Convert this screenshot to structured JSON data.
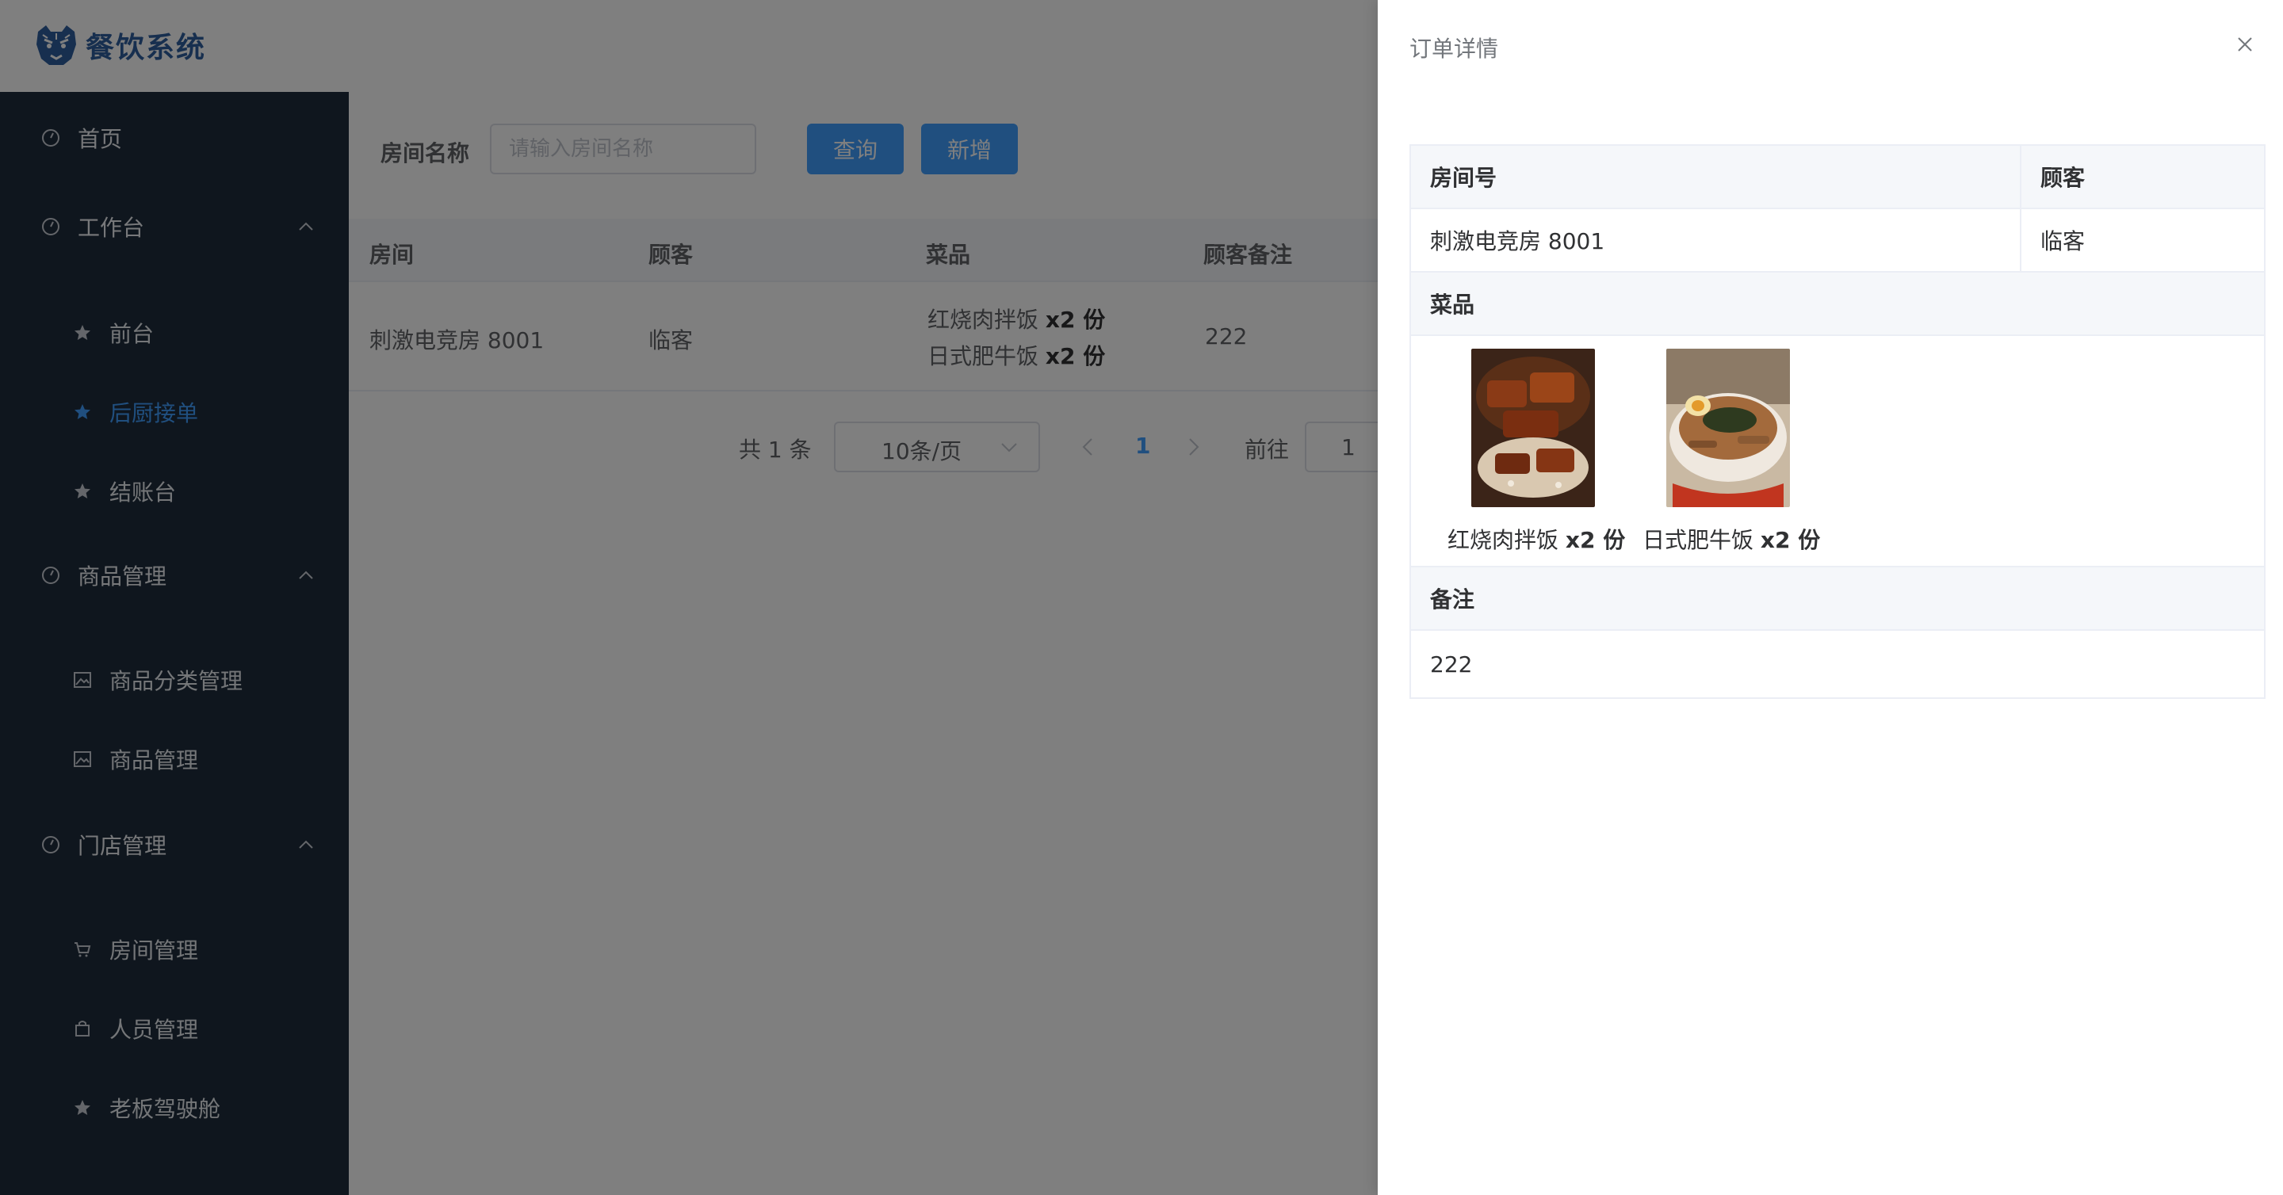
{
  "app": {
    "title": "餐饮系统"
  },
  "sidebar": {
    "items": [
      {
        "label": "首页",
        "icon": "dashboard-icon"
      },
      {
        "label": "工作台",
        "icon": "dashboard-icon",
        "children": [
          {
            "label": "前台",
            "icon": "star-icon"
          },
          {
            "label": "后厨接单",
            "icon": "star-icon",
            "active": true
          },
          {
            "label": "结账台",
            "icon": "star-icon"
          }
        ]
      },
      {
        "label": "商品管理",
        "icon": "dashboard-icon",
        "children": [
          {
            "label": "商品分类管理",
            "icon": "picture-icon"
          },
          {
            "label": "商品管理",
            "icon": "picture-icon"
          }
        ]
      },
      {
        "label": "门店管理",
        "icon": "dashboard-icon",
        "children": [
          {
            "label": "房间管理",
            "icon": "cart-icon"
          },
          {
            "label": "人员管理",
            "icon": "bag-icon"
          },
          {
            "label": "老板驾驶舱",
            "icon": "star-icon"
          }
        ]
      }
    ]
  },
  "search": {
    "label": "房间名称",
    "placeholder": "请输入房间名称",
    "query_button": "查询",
    "add_button": "新增"
  },
  "table": {
    "headers": [
      "房间",
      "顾客",
      "菜品",
      "顾客备注"
    ],
    "rows": [
      {
        "room": "刺激电竞房 8001",
        "customer": "临客",
        "dishes": [
          {
            "name": "红烧肉拌饭",
            "qty": "x2 份"
          },
          {
            "name": "日式肥牛饭",
            "qty": "x2 份"
          }
        ],
        "note": "222"
      }
    ]
  },
  "pagination": {
    "total": "共 1 条",
    "page_size": "10条/页",
    "current_page": "1",
    "goto_label": "前往",
    "goto_value": "1"
  },
  "drawer": {
    "title": "订单详情",
    "room_label": "房间号",
    "customer_label": "顾客",
    "room_value": "刺激电竞房 8001",
    "customer_value": "临客",
    "dishes_label": "菜品",
    "dishes": [
      {
        "name": "红烧肉拌饭",
        "qty": "x2 份"
      },
      {
        "name": "日式肥牛饭",
        "qty": "x2 份"
      }
    ],
    "note_label": "备注",
    "note_value": "222"
  },
  "colors": {
    "accent": "#409eff",
    "sidebar_bg": "#1f2d3d",
    "brand": "#2f5f9e"
  }
}
